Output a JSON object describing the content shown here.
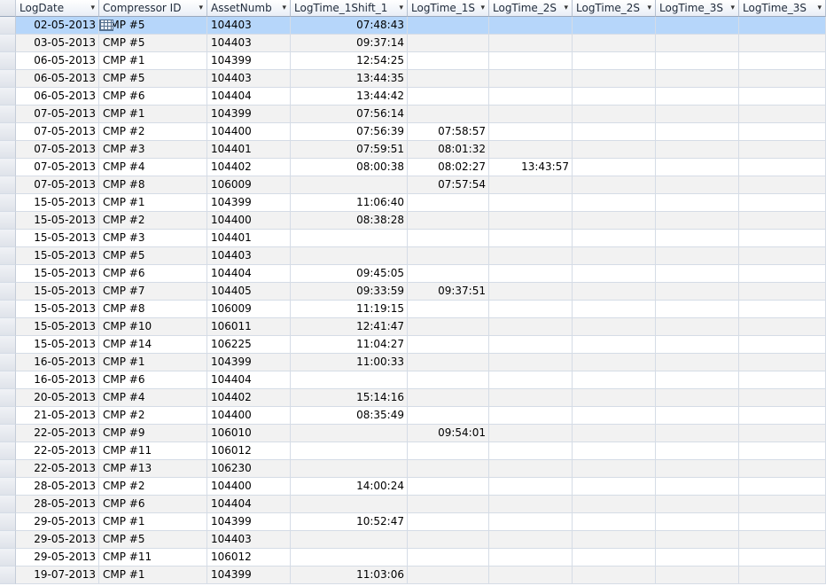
{
  "columns": [
    {
      "label": "LogDate",
      "arrow": "▾"
    },
    {
      "label": "Compressor ID",
      "arrow": "▾"
    },
    {
      "label": "AssetNumb",
      "arrow": "▾"
    },
    {
      "label": "LogTime_1Shift_1",
      "arrow": "▾"
    },
    {
      "label": "LogTime_1S",
      "arrow": "▾"
    },
    {
      "label": "LogTime_2S",
      "arrow": "▾"
    },
    {
      "label": "LogTime_2S",
      "arrow": "▾"
    },
    {
      "label": "LogTime_3S",
      "arrow": "▾"
    },
    {
      "label": "LogTime_3S",
      "arrow": "▾"
    }
  ],
  "rows": [
    [
      "02-05-2013",
      "CMP #5",
      "104403",
      "07:48:43",
      "",
      "",
      "",
      "",
      ""
    ],
    [
      "03-05-2013",
      "CMP #5",
      "104403",
      "09:37:14",
      "",
      "",
      "",
      "",
      ""
    ],
    [
      "06-05-2013",
      "CMP #1",
      "104399",
      "12:54:25",
      "",
      "",
      "",
      "",
      ""
    ],
    [
      "06-05-2013",
      "CMP #5",
      "104403",
      "13:44:35",
      "",
      "",
      "",
      "",
      ""
    ],
    [
      "06-05-2013",
      "CMP #6",
      "104404",
      "13:44:42",
      "",
      "",
      "",
      "",
      ""
    ],
    [
      "07-05-2013",
      "CMP #1",
      "104399",
      "07:56:14",
      "",
      "",
      "",
      "",
      ""
    ],
    [
      "07-05-2013",
      "CMP #2",
      "104400",
      "07:56:39",
      "07:58:57",
      "",
      "",
      "",
      ""
    ],
    [
      "07-05-2013",
      "CMP #3",
      "104401",
      "07:59:51",
      "08:01:32",
      "",
      "",
      "",
      ""
    ],
    [
      "07-05-2013",
      "CMP #4",
      "104402",
      "08:00:38",
      "08:02:27",
      "13:43:57",
      "",
      "",
      ""
    ],
    [
      "07-05-2013",
      "CMP #8",
      "106009",
      "",
      "07:57:54",
      "",
      "",
      "",
      ""
    ],
    [
      "15-05-2013",
      "CMP #1",
      "104399",
      "11:06:40",
      "",
      "",
      "",
      "",
      ""
    ],
    [
      "15-05-2013",
      "CMP #2",
      "104400",
      "08:38:28",
      "",
      "",
      "",
      "",
      ""
    ],
    [
      "15-05-2013",
      "CMP #3",
      "104401",
      "",
      "",
      "",
      "",
      "",
      ""
    ],
    [
      "15-05-2013",
      "CMP #5",
      "104403",
      "",
      "",
      "",
      "",
      "",
      ""
    ],
    [
      "15-05-2013",
      "CMP #6",
      "104404",
      "09:45:05",
      "",
      "",
      "",
      "",
      ""
    ],
    [
      "15-05-2013",
      "CMP #7",
      "104405",
      "09:33:59",
      "09:37:51",
      "",
      "",
      "",
      ""
    ],
    [
      "15-05-2013",
      "CMP #8",
      "106009",
      "11:19:15",
      "",
      "",
      "",
      "",
      ""
    ],
    [
      "15-05-2013",
      "CMP #10",
      "106011",
      "12:41:47",
      "",
      "",
      "",
      "",
      ""
    ],
    [
      "15-05-2013",
      "CMP #14",
      "106225",
      "11:04:27",
      "",
      "",
      "",
      "",
      ""
    ],
    [
      "16-05-2013",
      "CMP #1",
      "104399",
      "11:00:33",
      "",
      "",
      "",
      "",
      ""
    ],
    [
      "16-05-2013",
      "CMP #6",
      "104404",
      "",
      "",
      "",
      "",
      "",
      ""
    ],
    [
      "20-05-2013",
      "CMP #4",
      "104402",
      "15:14:16",
      "",
      "",
      "",
      "",
      ""
    ],
    [
      "21-05-2013",
      "CMP #2",
      "104400",
      "08:35:49",
      "",
      "",
      "",
      "",
      ""
    ],
    [
      "22-05-2013",
      "CMP #9",
      "106010",
      "",
      "09:54:01",
      "",
      "",
      "",
      ""
    ],
    [
      "22-05-2013",
      "CMP #11",
      "106012",
      "",
      "",
      "",
      "",
      "",
      ""
    ],
    [
      "22-05-2013",
      "CMP #13",
      "106230",
      "",
      "",
      "",
      "",
      "",
      ""
    ],
    [
      "28-05-2013",
      "CMP #2",
      "104400",
      "14:00:24",
      "",
      "",
      "",
      "",
      ""
    ],
    [
      "28-05-2013",
      "CMP #6",
      "104404",
      "",
      "",
      "",
      "",
      "",
      ""
    ],
    [
      "29-05-2013",
      "CMP #1",
      "104399",
      "10:52:47",
      "",
      "",
      "",
      "",
      ""
    ],
    [
      "29-05-2013",
      "CMP #5",
      "104403",
      "",
      "",
      "",
      "",
      "",
      ""
    ],
    [
      "29-05-2013",
      "CMP #11",
      "106012",
      "",
      "",
      "",
      "",
      "",
      ""
    ],
    [
      "19-07-2013",
      "CMP #1",
      "104399",
      "11:03:06",
      "",
      "",
      "",
      "",
      ""
    ]
  ],
  "current_row_index": 0,
  "colors": {
    "current_row": "#b6d6fa",
    "alt_row": "#f2f2f2",
    "grid_line": "#d5dce6",
    "header_bg": "#e9eef6"
  },
  "icons": {
    "active_cell": "table-grid-icon",
    "sort_filter": "dropdown-arrow-icon"
  }
}
